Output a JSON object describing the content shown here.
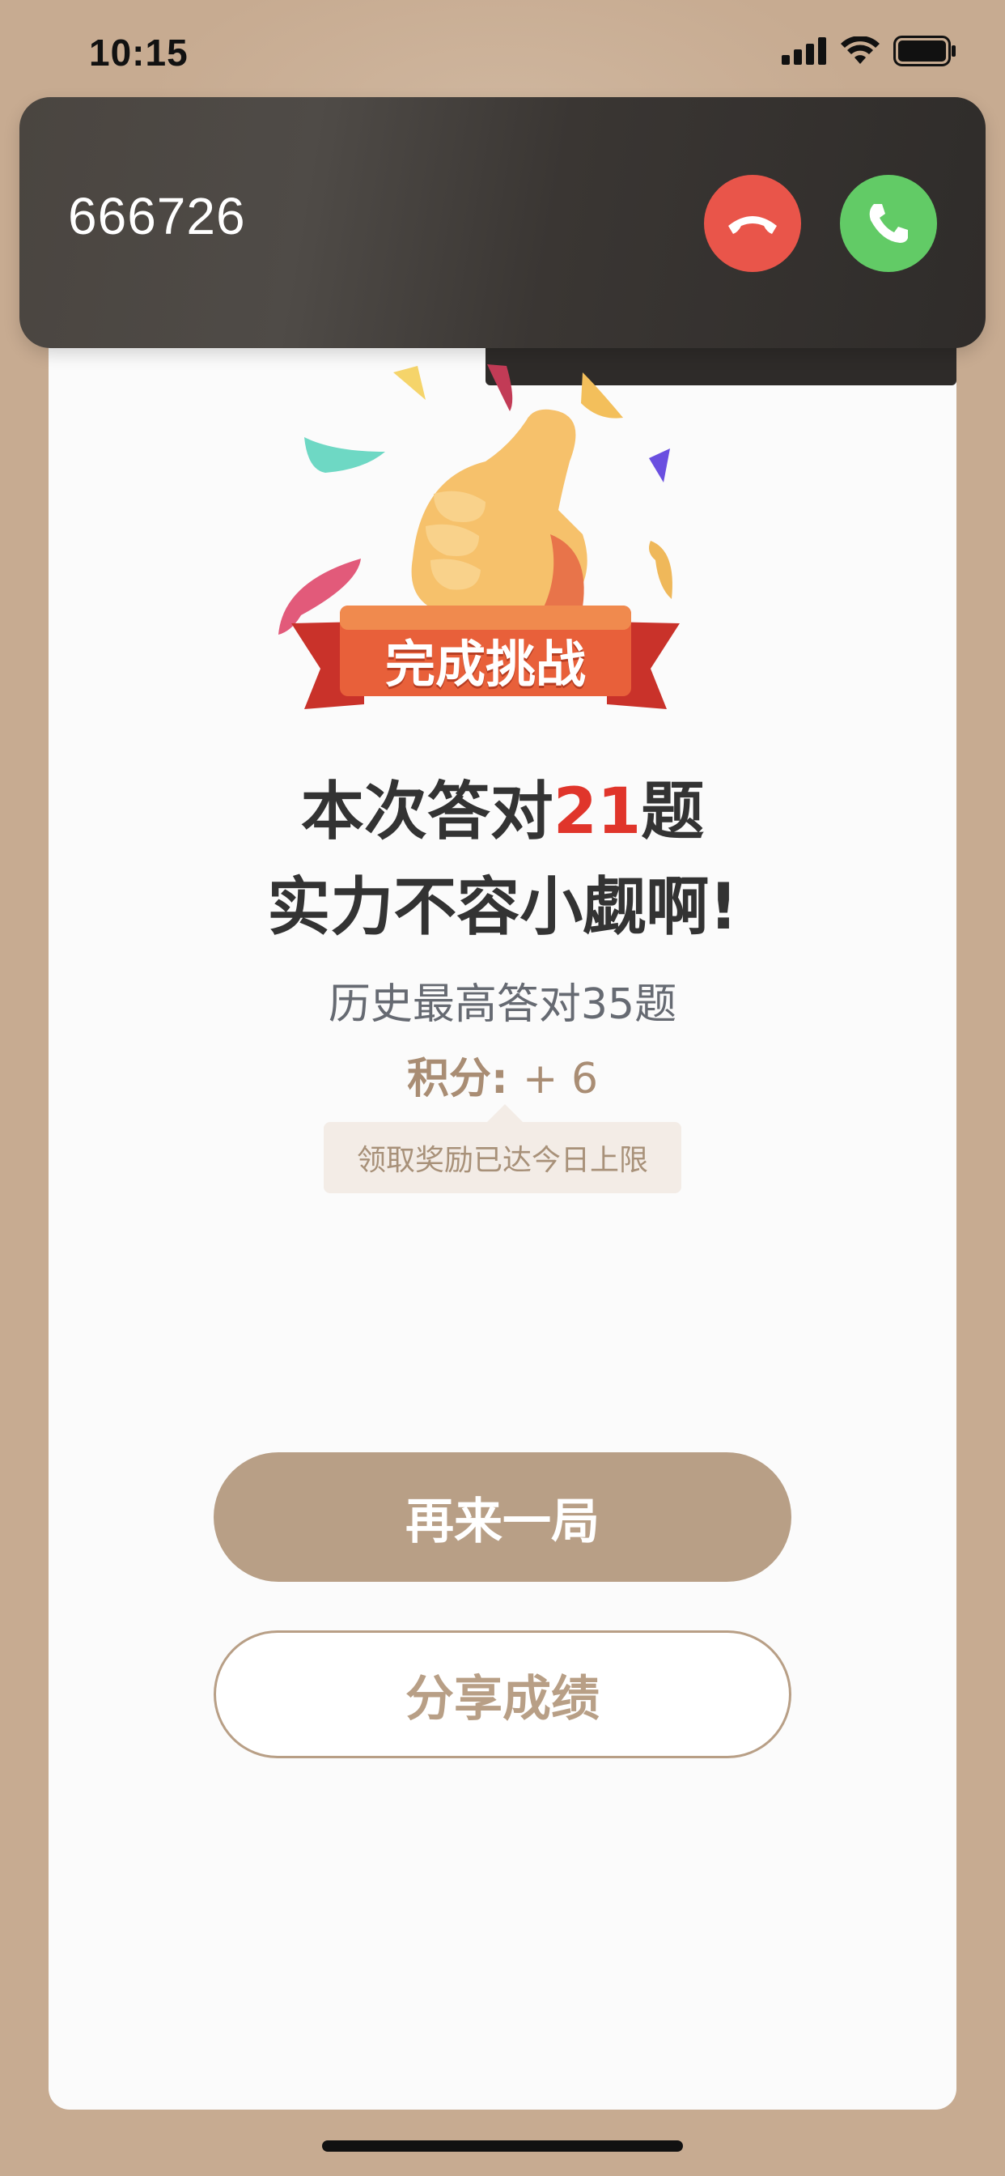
{
  "status_bar": {
    "time": "10:15"
  },
  "call": {
    "caller": "666726"
  },
  "result": {
    "ribbon_label": "完成挑战",
    "line1_prefix": "本次答对",
    "line1_count": "21",
    "line1_suffix": "题",
    "line2": "实力不容小觑啊!",
    "history": "历史最高答对35题",
    "points_label": "积分:",
    "points_value": "+ 6",
    "tip": "领取奖励已达今日上限"
  },
  "actions": {
    "replay_label": "再来一局",
    "share_label": "分享成绩"
  },
  "colors": {
    "background": "#c7ab91",
    "accent": "#b89f86",
    "highlight": "#e0352b",
    "decline": "#e9554a",
    "accept": "#62cb66"
  }
}
